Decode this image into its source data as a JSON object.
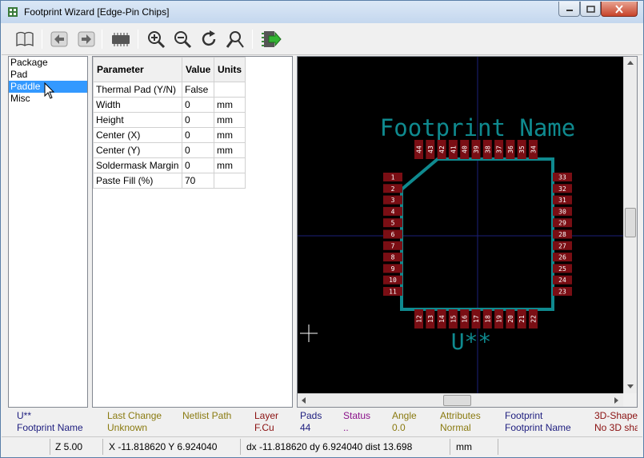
{
  "window": {
    "title": "Footprint Wizard [Edge-Pin Chips]"
  },
  "toolbar": {
    "buttons": [
      "select-wizard",
      "previous",
      "next",
      "show-footprint",
      "zoom-in",
      "zoom-out",
      "redraw",
      "zoom-auto",
      "export-footprint"
    ]
  },
  "pages": [
    {
      "label": "Package",
      "selected": false
    },
    {
      "label": "Pad",
      "selected": false
    },
    {
      "label": "Paddle",
      "selected": true
    },
    {
      "label": "Misc",
      "selected": false
    }
  ],
  "grid": {
    "headers": [
      "Parameter",
      "Value",
      "Units"
    ],
    "rows": [
      [
        "Thermal Pad (Y/N)",
        "False",
        ""
      ],
      [
        "Width",
        "0",
        "mm"
      ],
      [
        "Height",
        "0",
        "mm"
      ],
      [
        "Center (X)",
        "0",
        "mm"
      ],
      [
        "Center (Y)",
        "0",
        "mm"
      ],
      [
        "Soldermask Margin",
        "0",
        "mm"
      ],
      [
        "Paste Fill (%)",
        "70",
        ""
      ]
    ]
  },
  "preview": {
    "value_text": "Footprint Name",
    "reference_text": "U**",
    "left_pads": [
      "1",
      "2",
      "3",
      "4",
      "5",
      "6",
      "7",
      "8",
      "9",
      "10",
      "11"
    ],
    "bottom_pads": [
      "12",
      "13",
      "14",
      "15",
      "16",
      "17",
      "18",
      "19",
      "20",
      "21",
      "22"
    ],
    "right_pads": [
      "33",
      "32",
      "31",
      "30",
      "29",
      "28",
      "27",
      "26",
      "25",
      "24",
      "23"
    ],
    "top_pads": [
      "44",
      "43",
      "42",
      "41",
      "40",
      "39",
      "38",
      "37",
      "36",
      "35",
      "34"
    ],
    "colors": {
      "background": "#000000",
      "outline": "#0f8a8f",
      "pad": "#7a0e14",
      "pad_text": "#ffffff",
      "axis": "#1b1f7a"
    }
  },
  "messages": [
    {
      "label": "U**",
      "value": "Footprint Name",
      "label_color": "#202080",
      "value_color": "#202080"
    },
    {
      "label": "Last Change",
      "value": "Unknown",
      "label_color": "#8a7a10",
      "value_color": "#8a7a10"
    },
    {
      "label": "Netlist Path",
      "value": "",
      "label_color": "#8a7a10",
      "value_color": "#8a7a10"
    },
    {
      "label": "Layer",
      "value": "F.Cu",
      "label_color": "#8a1010",
      "value_color": "#8a1010"
    },
    {
      "label": "Pads",
      "value": "44",
      "label_color": "#202080",
      "value_color": "#202080"
    },
    {
      "label": "Status",
      "value": "..",
      "label_color": "#8a108a",
      "value_color": "#8a108a"
    },
    {
      "label": "Angle",
      "value": "0.0",
      "label_color": "#8a7a10",
      "value_color": "#8a7a10"
    },
    {
      "label": "Attributes",
      "value": "Normal",
      "label_color": "#8a7a10",
      "value_color": "#8a7a10"
    },
    {
      "label": "Footprint",
      "value": "Footprint Name",
      "label_color": "#202080",
      "value_color": "#202080"
    },
    {
      "label": "3D-Shape",
      "value": "No 3D sha",
      "label_color": "#8a1010",
      "value_color": "#8a1010"
    }
  ],
  "status": {
    "zoom": "Z 5.00",
    "xy": "X -11.818620  Y 6.924040",
    "delta": "dx -11.818620  dy 6.924040  dist 13.698",
    "units": "mm"
  }
}
